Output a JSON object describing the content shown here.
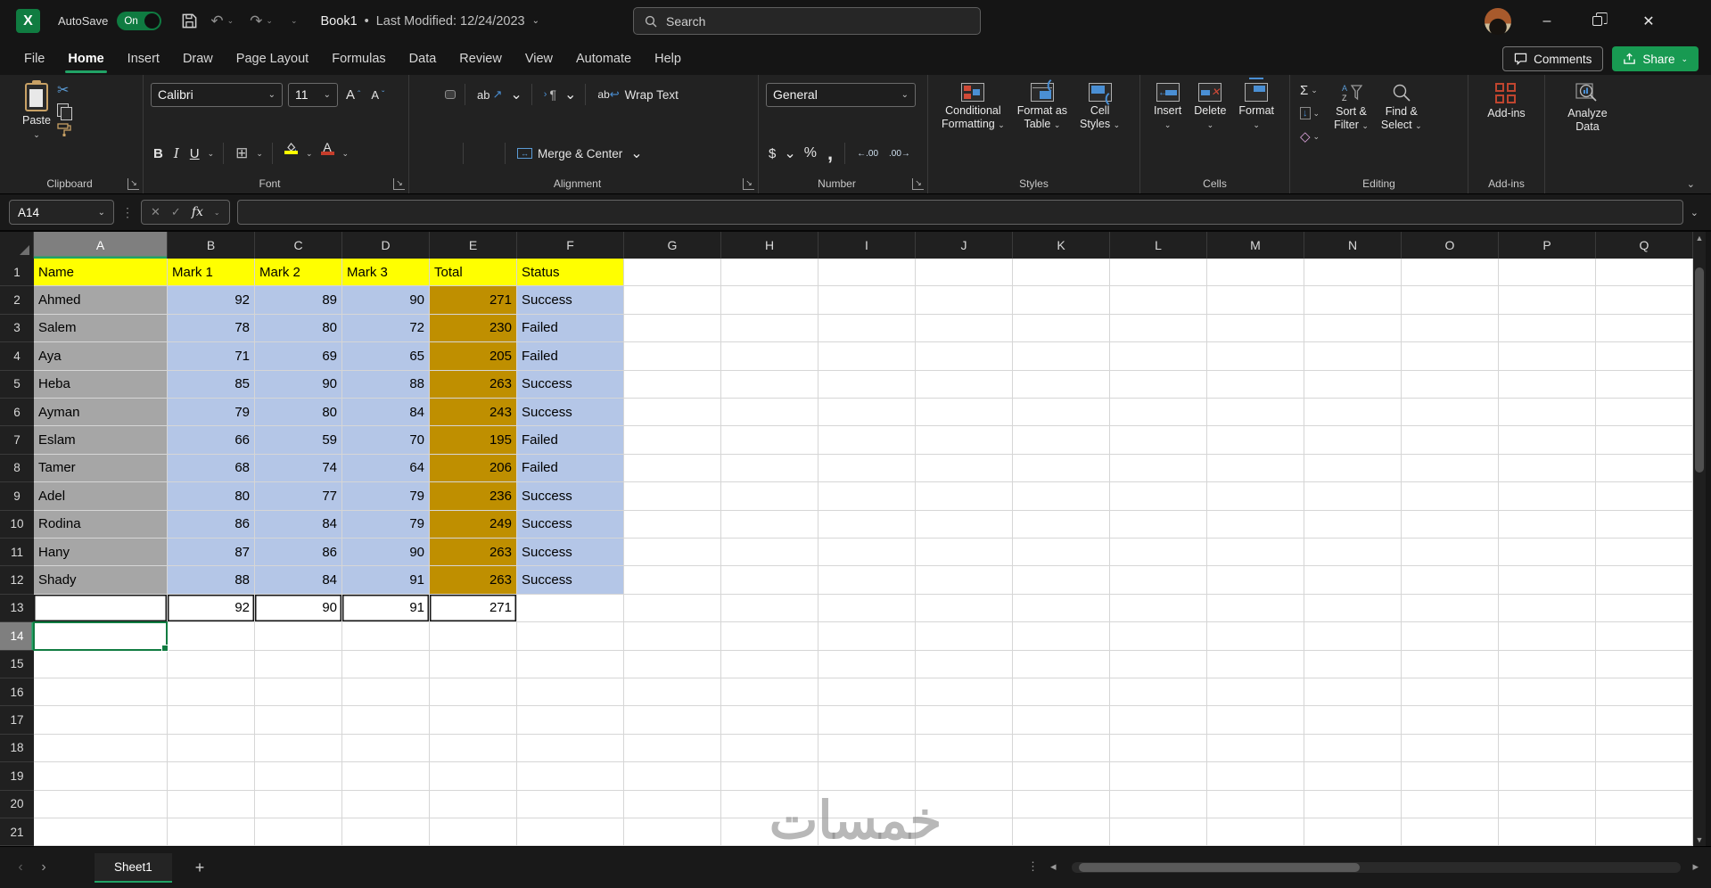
{
  "titlebar": {
    "autosave_label": "AutoSave",
    "autosave_state": "On",
    "doc_title": "Book1",
    "doc_sep": "•",
    "modified": "Last Modified: 12/24/2023",
    "search_placeholder": "Search",
    "logo_letter": "X"
  },
  "tabs": [
    {
      "label": "File",
      "selected": false
    },
    {
      "label": "Home",
      "selected": true
    },
    {
      "label": "Insert",
      "selected": false
    },
    {
      "label": "Draw",
      "selected": false
    },
    {
      "label": "Page Layout",
      "selected": false
    },
    {
      "label": "Formulas",
      "selected": false
    },
    {
      "label": "Data",
      "selected": false
    },
    {
      "label": "Review",
      "selected": false
    },
    {
      "label": "View",
      "selected": false
    },
    {
      "label": "Automate",
      "selected": false
    },
    {
      "label": "Help",
      "selected": false
    }
  ],
  "top_right": {
    "comments": "Comments",
    "share": "Share"
  },
  "ribbon": {
    "paste": "Paste",
    "font_name": "Calibri",
    "font_size": "11",
    "bold": "B",
    "italic": "I",
    "underline": "U",
    "grow_font": "A",
    "shrink_font": "A",
    "orientation_ab": "ab",
    "orientation_arrow": "↗",
    "wrap_text": "Wrap Text",
    "merge_center": "Merge & Center",
    "number_format": "General",
    "dollar": "$",
    "percent": "%",
    "comma": ",",
    "inc_decimal": "←.00",
    "dec_decimal": ".00→",
    "cond_fmt_1": "Conditional",
    "cond_fmt_2": "Formatting",
    "fmt_table_1": "Format as",
    "fmt_table_2": "Table",
    "cell_styles_1": "Cell",
    "cell_styles_2": "Styles",
    "insert": "Insert",
    "delete": "Delete",
    "format": "Format",
    "sigma": "Σ",
    "sort_filter_1": "Sort &",
    "sort_filter_2": "Filter",
    "find_select_1": "Find &",
    "find_select_2": "Select",
    "addins": "Add-ins",
    "analyze_1": "Analyze",
    "analyze_2": "Data",
    "group_labels": {
      "clipboard": "Clipboard",
      "font": "Font",
      "alignment": "Alignment",
      "number": "Number",
      "styles": "Styles",
      "cells": "Cells",
      "editing": "Editing",
      "addins": "Add-ins"
    }
  },
  "formula_bar": {
    "name_box": "A14",
    "fx": "fx",
    "formula": ""
  },
  "grid": {
    "columns": [
      "A",
      "B",
      "C",
      "D",
      "E",
      "F",
      "G",
      "H",
      "I",
      "J",
      "K",
      "L",
      "M",
      "N",
      "O",
      "P",
      "Q"
    ],
    "row_numbers": [
      1,
      2,
      3,
      4,
      5,
      6,
      7,
      8,
      9,
      10,
      11,
      12,
      13,
      14,
      15,
      16,
      17,
      18,
      19,
      20,
      21
    ],
    "header_row": [
      "Name",
      "Mark 1",
      "Mark 2",
      "Mark 3",
      "Total",
      "Status"
    ],
    "students": [
      [
        "Ahmed",
        92,
        89,
        90,
        271,
        "Success"
      ],
      [
        "Salem",
        78,
        80,
        72,
        230,
        "Failed"
      ],
      [
        "Aya",
        71,
        69,
        65,
        205,
        "Failed"
      ],
      [
        "Heba",
        85,
        90,
        88,
        263,
        "Success"
      ],
      [
        "Ayman",
        79,
        80,
        84,
        243,
        "Success"
      ],
      [
        "Eslam",
        66,
        59,
        70,
        195,
        "Failed"
      ],
      [
        "Tamer",
        68,
        74,
        64,
        206,
        "Failed"
      ],
      [
        "Adel",
        80,
        77,
        79,
        236,
        "Success"
      ],
      [
        "Rodina",
        86,
        84,
        79,
        249,
        "Success"
      ],
      [
        "Hany",
        87,
        86,
        90,
        263,
        "Success"
      ],
      [
        "Shady",
        88,
        84,
        91,
        263,
        "Success"
      ]
    ],
    "summary_row": [
      "",
      92,
      90,
      91,
      271,
      ""
    ],
    "summary_row_number": 13,
    "active_cell": "A14",
    "selected_column": "A",
    "selected_row": 14,
    "column_fills": {
      "A": "gray",
      "B": "blue",
      "C": "blue",
      "D": "blue",
      "E": "gold",
      "F": "blue"
    },
    "fills": {
      "yellow": "#FFFF00",
      "gray": "#A6A6A6",
      "blue": "#B4C6E7",
      "gold": "#BF8F00"
    }
  },
  "sheet_bar": {
    "active_tab": "Sheet1",
    "add_sheet": "+"
  },
  "watermark": "خمسات",
  "icons": {
    "chevron": "⌄",
    "undo": "↶",
    "redo": "↷",
    "more_v": "⋮",
    "minimize": "–",
    "close": "✕",
    "scissors": "✂",
    "borders": "⊞",
    "pilcrow": "¶",
    "wrap_arrow": "↩",
    "merge_arrow": "↔",
    "eraser": "◇",
    "fill_down": "↓",
    "nav_left": "‹",
    "nav_right": "›",
    "tri_up": "▲",
    "tri_down": "▼",
    "tri_left": "◂",
    "tri_right": "▸",
    "caret_up": "ˆ",
    "caret_down": "ˇ",
    "x_mark": "✕",
    "check_mark": "✓",
    "funnel_az": "A↓Z"
  },
  "colors": {
    "accent_green": "#21A366",
    "selection_green": "#107C41",
    "header_yellow": "#FFFF00",
    "name_gray": "#A6A6A6",
    "marks_blue": "#B4C6E7",
    "total_gold": "#BF8F00",
    "fill_icon_yellow": "#FFFF00",
    "font_color_red": "#C63D2B",
    "addins_red": "#C0452F"
  }
}
